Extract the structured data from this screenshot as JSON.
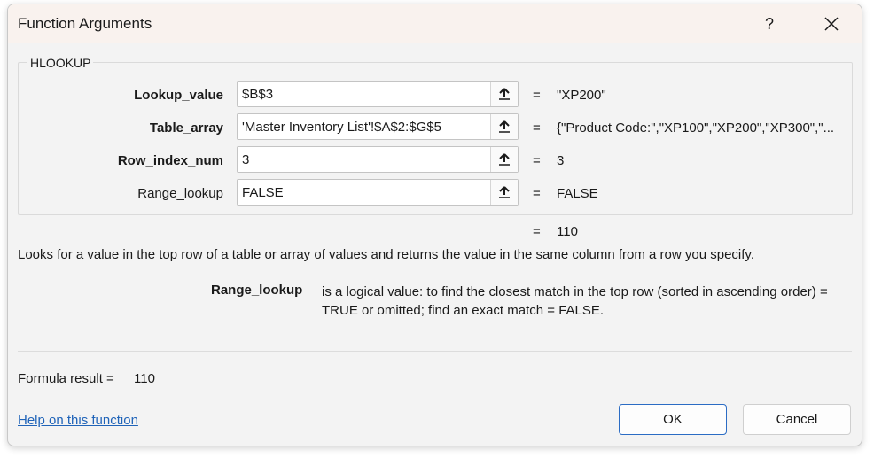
{
  "dialog": {
    "title": "Function Arguments",
    "help_glyph": "?",
    "close_icon": "close-icon"
  },
  "function": {
    "name": "HLOOKUP",
    "arguments": [
      {
        "label": "Lookup_value",
        "bold": true,
        "value": "$B$3",
        "result": "\"XP200\""
      },
      {
        "label": "Table_array",
        "bold": true,
        "value": "'Master Inventory List'!$A$2:$G$5",
        "result": "{\"Product Code:\",\"XP100\",\"XP200\",\"XP300\",\"..."
      },
      {
        "label": "Row_index_num",
        "bold": true,
        "value": "3",
        "result": "3"
      },
      {
        "label": "Range_lookup",
        "bold": false,
        "value": "FALSE",
        "result": "FALSE"
      }
    ],
    "equals": "=",
    "overall_result": "110",
    "description": "Looks for a value in the top row of a table or array of values and returns the value in the same column from a row you specify.",
    "param_name": "Range_lookup",
    "param_description": "is a logical value: to find the closest match in the top row (sorted in ascending order) = TRUE or omitted; find an exact match = FALSE."
  },
  "footer": {
    "formula_result_label": "Formula result =",
    "formula_result_value": "110",
    "help_link": "Help on this function",
    "ok_label": "OK",
    "cancel_label": "Cancel"
  },
  "colors": {
    "link": "#1f63b8",
    "ok_border": "#2b6cc4"
  }
}
